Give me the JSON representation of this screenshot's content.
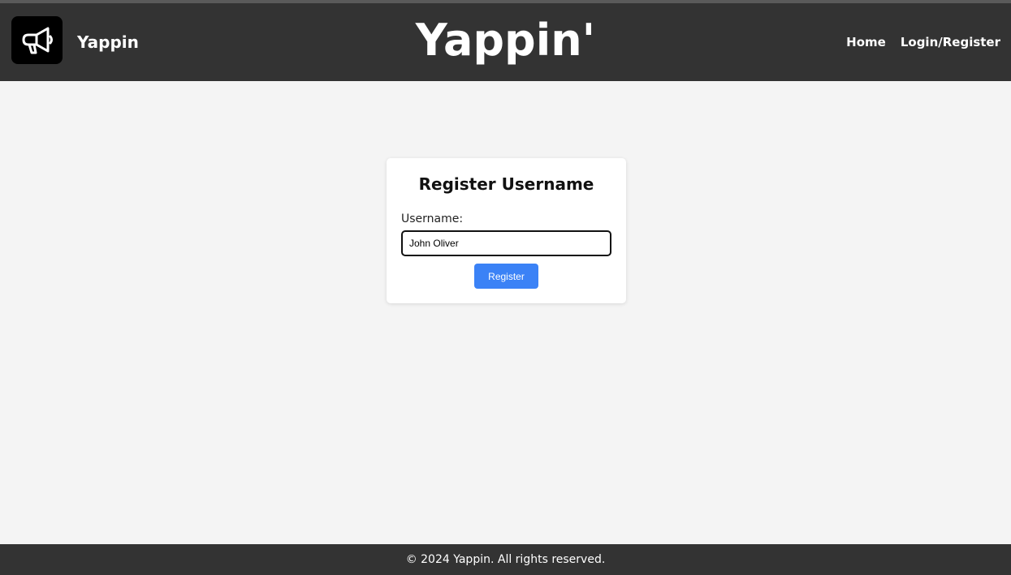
{
  "header": {
    "brand_name": "Yappin",
    "site_title": "Yappin'",
    "logo_icon": "megaphone-icon",
    "nav": [
      {
        "label": "Home"
      },
      {
        "label": "Login/Register"
      }
    ]
  },
  "register": {
    "heading": "Register Username",
    "username_label": "Username:",
    "username_value": "John Oliver",
    "submit_label": "Register"
  },
  "footer": {
    "text": "© 2024 Yappin. All rights reserved."
  },
  "colors": {
    "header_bg": "#333333",
    "page_bg": "#f4f4f4",
    "button_bg": "#3b82f6"
  }
}
